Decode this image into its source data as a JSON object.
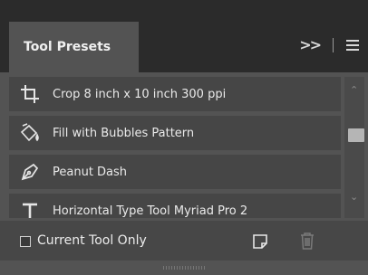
{
  "panel": {
    "title": "Tool Presets"
  },
  "header": {
    "expand_glyph": ">>"
  },
  "presets": [
    {
      "label": "Crop 8 inch x 10 inch 300 ppi",
      "icon": "crop-icon"
    },
    {
      "label": "Fill with Bubbles Pattern",
      "icon": "paint-bucket-icon"
    },
    {
      "label": "Peanut Dash",
      "icon": "pen-icon"
    },
    {
      "label": "Horizontal Type Tool Myriad Pro 2",
      "icon": "type-tool-icon"
    }
  ],
  "footer": {
    "current_tool_only_label": "Current Tool Only",
    "current_tool_only_checked": false
  },
  "colors": {
    "panel_bg": "#535353",
    "header_bg": "#2b2b2b",
    "item_bg": "#464646",
    "text": "#e6e6e6"
  }
}
